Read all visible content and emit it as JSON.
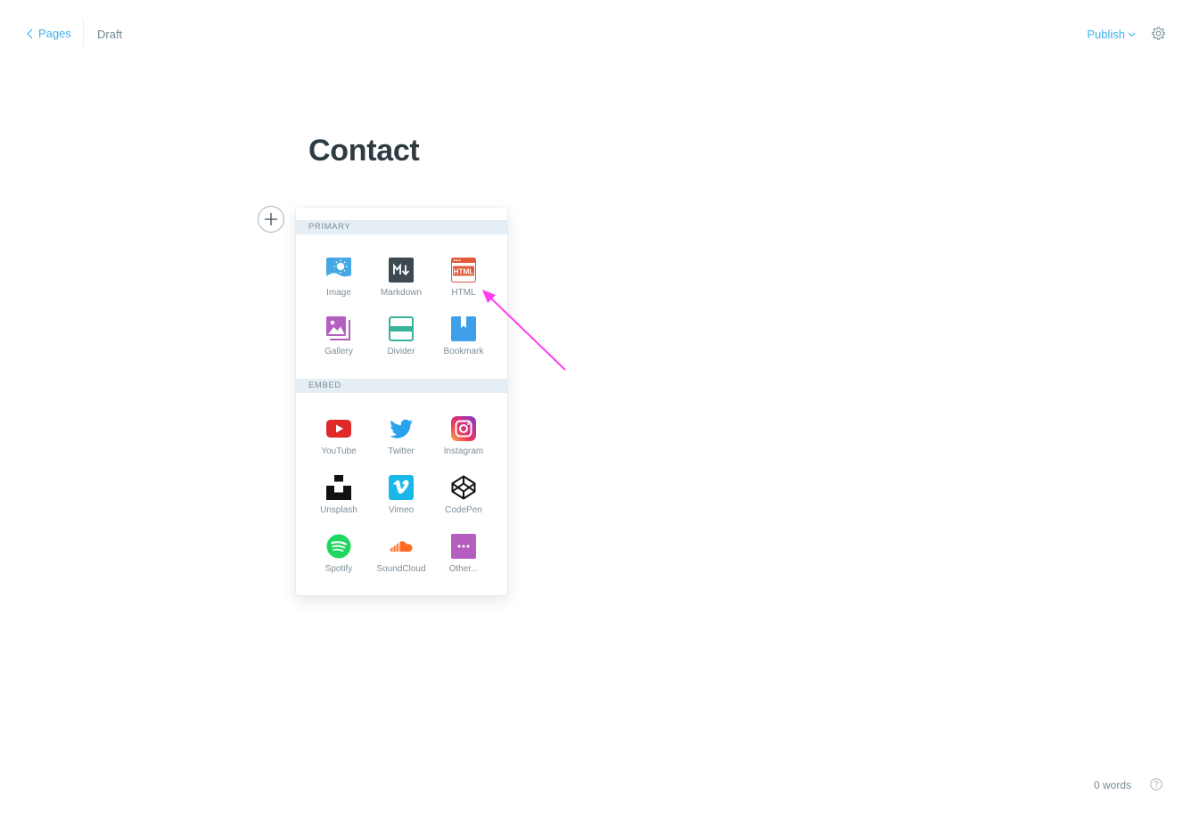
{
  "header": {
    "back_label": "Pages",
    "status": "Draft",
    "publish_label": "Publish"
  },
  "editor": {
    "title": "Contact"
  },
  "card_menu": {
    "sections": [
      {
        "label": "PRIMARY",
        "items": [
          {
            "label": "Image",
            "icon": "image-icon"
          },
          {
            "label": "Markdown",
            "icon": "markdown-icon"
          },
          {
            "label": "HTML",
            "icon": "html-icon"
          },
          {
            "label": "Gallery",
            "icon": "gallery-icon"
          },
          {
            "label": "Divider",
            "icon": "divider-icon"
          },
          {
            "label": "Bookmark",
            "icon": "bookmark-icon"
          }
        ]
      },
      {
        "label": "EMBED",
        "items": [
          {
            "label": "YouTube",
            "icon": "youtube-icon"
          },
          {
            "label": "Twitter",
            "icon": "twitter-icon"
          },
          {
            "label": "Instagram",
            "icon": "instagram-icon"
          },
          {
            "label": "Unsplash",
            "icon": "unsplash-icon"
          },
          {
            "label": "Vimeo",
            "icon": "vimeo-icon"
          },
          {
            "label": "CodePen",
            "icon": "codepen-icon"
          },
          {
            "label": "Spotify",
            "icon": "spotify-icon"
          },
          {
            "label": "SoundCloud",
            "icon": "soundcloud-icon"
          },
          {
            "label": "Other...",
            "icon": "other-icon"
          }
        ]
      }
    ]
  },
  "footer": {
    "word_count": "0 words"
  },
  "colors": {
    "accent": "#3eb0ef",
    "annotation_arrow": "#ff3cf0"
  }
}
